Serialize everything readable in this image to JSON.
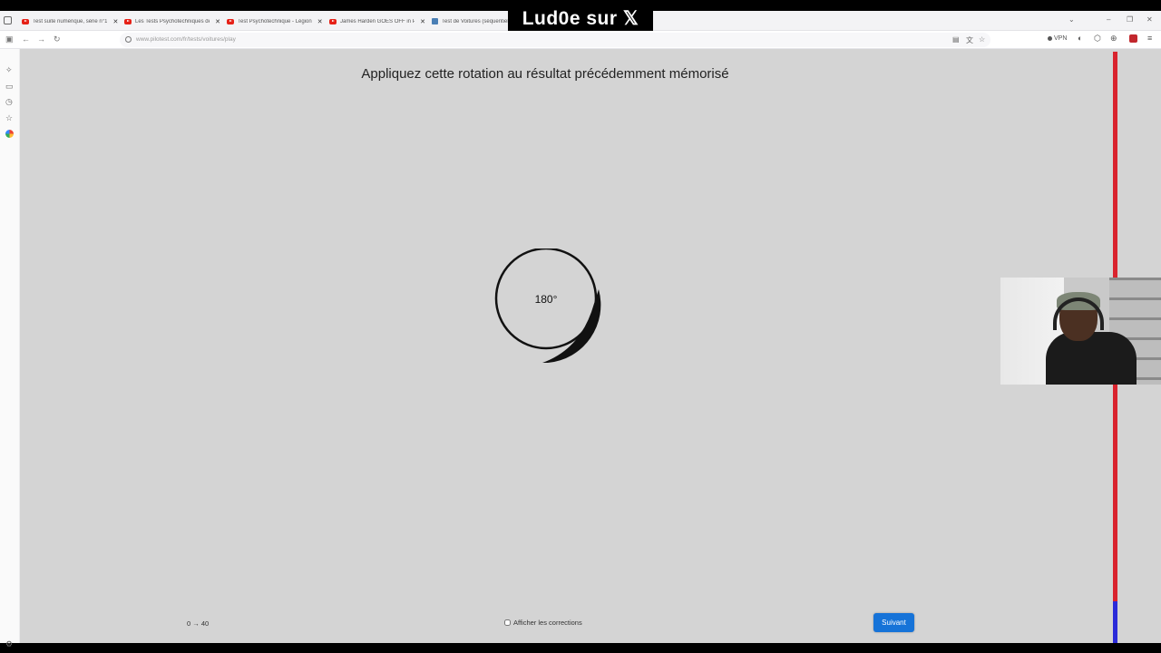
{
  "overlay": {
    "banner": "Lud0e sur 𝕏"
  },
  "browser": {
    "tabs": [
      {
        "label": "Test suite numérique, série n°1",
        "icon": "youtube-icon"
      },
      {
        "label": "Les Tests Psychotechniques de",
        "icon": "youtube-icon"
      },
      {
        "label": "Test Psychotechnique - Légion",
        "icon": "youtube-icon"
      },
      {
        "label": "James Harden GOES OFF in Pro",
        "icon": "youtube-icon"
      },
      {
        "label": "Test de Voitures (séquentiel)",
        "icon": "page-icon"
      }
    ],
    "url": "www.pilotest.com/fr/tests/voitures/play",
    "vpn_label": "VPN"
  },
  "page": {
    "instruction": "Appliquez cette rotation au résultat précédemment mémorisé",
    "rotation_label": "180°",
    "counter": "0 → 40",
    "corrections_label": "Afficher les corrections",
    "corrections_checked": false,
    "next_label": "Suivant",
    "timer_remaining_fraction": 0.07,
    "colors": {
      "background": "#d4d4d4",
      "button": "#1673d8",
      "timer": "#d9232e",
      "timer_fill": "#2b2bd9"
    }
  }
}
